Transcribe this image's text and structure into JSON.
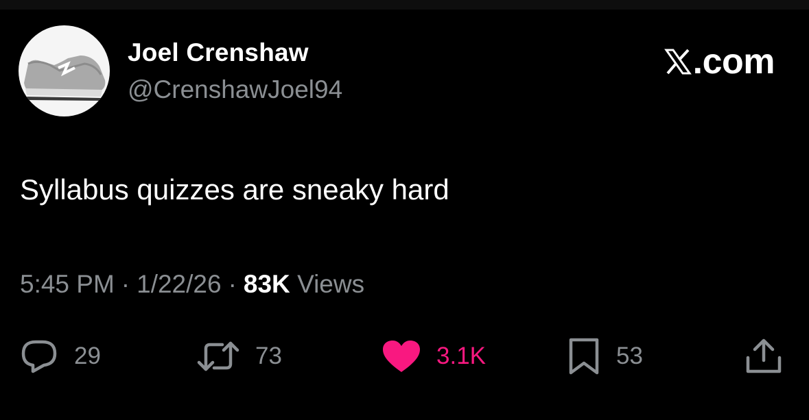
{
  "author": {
    "display_name": "Joel Crenshaw",
    "handle": "@CrenshawJoel94",
    "avatar_icon": "sneaker-image"
  },
  "brand": {
    "label": ".com",
    "logo_icon": "x-logo-icon"
  },
  "tweet": {
    "text": "Syllabus quizzes are sneaky hard"
  },
  "meta": {
    "time": "5:45 PM",
    "separator": "·",
    "date": "1/22/26",
    "views_count": "83K",
    "views_label": "Views"
  },
  "actions": {
    "replies": {
      "icon": "reply-icon",
      "count": "29"
    },
    "reposts": {
      "icon": "repost-icon",
      "count": "73"
    },
    "likes": {
      "icon": "heart-icon",
      "count": "3.1K",
      "liked": true
    },
    "bookmarks": {
      "icon": "bookmark-icon",
      "count": "53"
    },
    "share": {
      "icon": "share-icon"
    }
  },
  "colors": {
    "background": "#000000",
    "primary_text": "#ffffff",
    "secondary_text": "#8b8f93",
    "like_accent": "#f91880"
  }
}
